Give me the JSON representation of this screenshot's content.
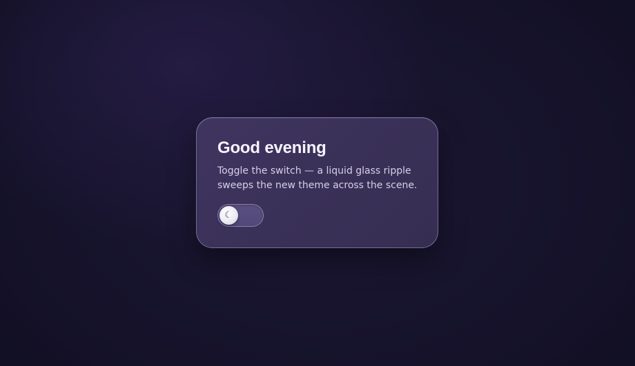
{
  "card": {
    "title": "Good evening",
    "description": "Toggle the switch — a liquid glass ripple sweeps the new theme across the scene."
  },
  "theme_toggle": {
    "state": "off",
    "knob_icon": "moon-icon",
    "knob_glyph": "☾"
  },
  "colors": {
    "background": "#15122a",
    "card": "#3b3259",
    "title_text": "#f6f3ff",
    "body_text": "#d6d0ea",
    "toggle_track": "#554b7c",
    "knob": "#ecebf3"
  }
}
